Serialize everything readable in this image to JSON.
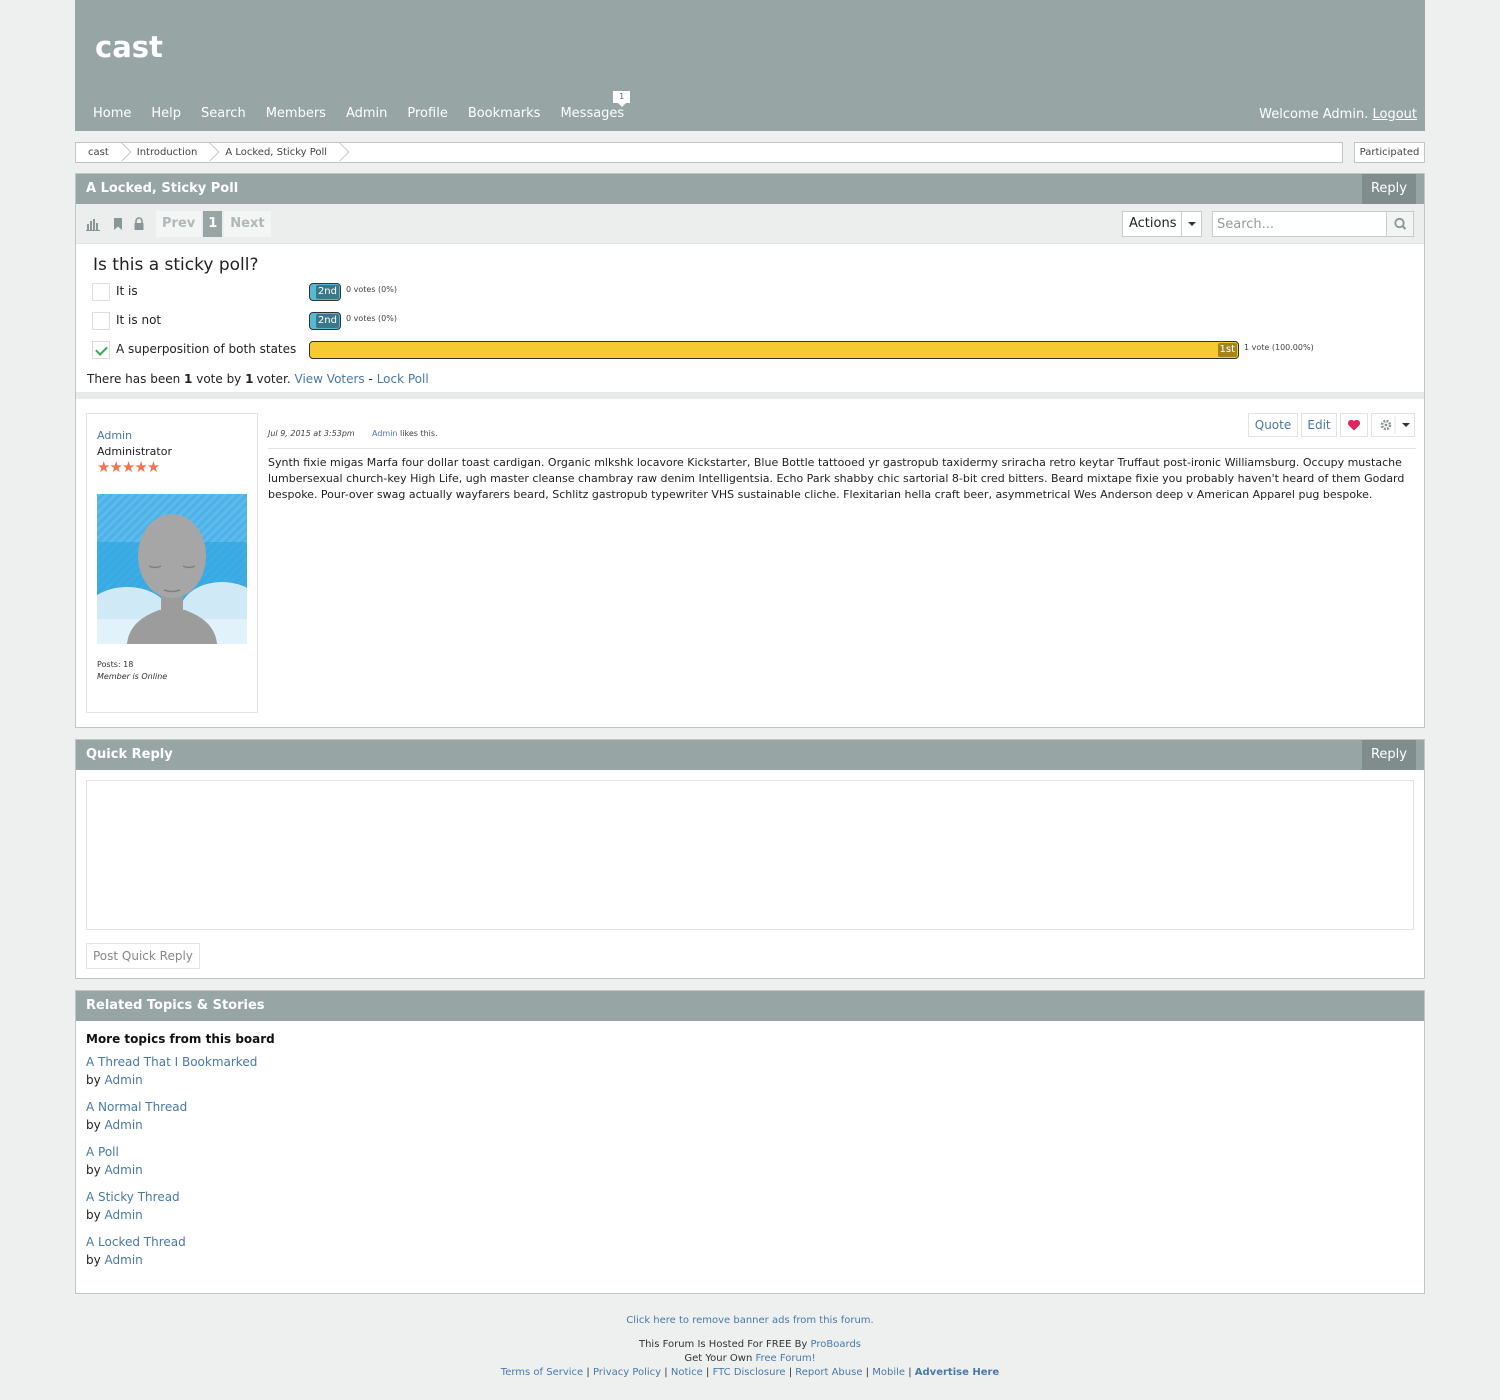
{
  "header": {
    "site_title": "cast",
    "nav": [
      {
        "label": "Home"
      },
      {
        "label": "Help"
      },
      {
        "label": "Search"
      },
      {
        "label": "Members"
      },
      {
        "label": "Admin"
      },
      {
        "label": "Profile"
      },
      {
        "label": "Bookmarks"
      },
      {
        "label": "Messages",
        "badge": "1"
      }
    ],
    "welcome_text": "Welcome Admin.",
    "logout_label": "Logout"
  },
  "breadcrumb": [
    "cast",
    "Introduction",
    "A Locked, Sticky Poll"
  ],
  "participated_label": "Participated",
  "thread": {
    "title": "A Locked, Sticky Poll",
    "reply_label": "Reply",
    "toolbar": {
      "icons": [
        "poll-icon",
        "bookmark-icon",
        "lock-icon"
      ],
      "prev_label": "Prev",
      "current_page": "1",
      "next_label": "Next",
      "actions_label": "Actions",
      "search_placeholder": "Search..."
    },
    "poll": {
      "question": "Is this a sticky poll?",
      "options": [
        {
          "label": "It is",
          "rank": "2nd",
          "votes_text": "0 votes (0%)",
          "checked": false,
          "color": "#58b9d1",
          "fraction": 0.0
        },
        {
          "label": "It is not",
          "rank": "2nd",
          "votes_text": "0 votes (0%)",
          "checked": false,
          "color": "#58b9d1",
          "fraction": 0.0
        },
        {
          "label": "A superposition of both states",
          "rank": "1st",
          "votes_text": "1 vote (100.00%)",
          "checked": true,
          "color": "#f6cb31",
          "fraction": 1.0
        }
      ],
      "summary_prefix": "There has been",
      "vote_count": "1",
      "summary_mid": "vote by",
      "voter_count": "1",
      "summary_suffix": "voter.",
      "view_voters_label": "View Voters",
      "summary_dash": "-",
      "lock_poll_label": "Lock Poll"
    },
    "post": {
      "author": "Admin",
      "author_title": "Administrator",
      "stars": "★★★★★",
      "posts_count": "Posts: 18",
      "online_status": "Member is Online",
      "date": "Jul 9, 2015 at 3:53pm",
      "likes_user": "Admin",
      "likes_text": "likes this.",
      "quote_label": "Quote",
      "edit_label": "Edit",
      "body": "Synth fixie migas Marfa four dollar toast cardigan. Organic mlkshk locavore Kickstarter, Blue Bottle tattooed yr gastropub taxidermy sriracha retro keytar Truffaut post-ironic Williamsburg. Occupy mustache lumbersexual church-key High Life, ugh master cleanse chambray raw denim Intelligentsia. Echo Park shabby chic sartorial 8-bit cred bitters. Beard mixtape fixie you probably haven't heard of them Godard bespoke. Pour-over swag actually wayfarers beard, Schlitz gastropub typewriter VHS sustainable cliche. Flexitarian hella craft beer, asymmetrical Wes Anderson deep v American Apparel pug bespoke."
    }
  },
  "quick_reply": {
    "title": "Quick Reply",
    "reply_label": "Reply",
    "submit_label": "Post Quick Reply"
  },
  "related": {
    "title": "Related Topics & Stories",
    "heading": "More topics from this board",
    "by_label": "by",
    "topics": [
      {
        "title": "A Thread That I Bookmarked",
        "author": "Admin"
      },
      {
        "title": "A Normal Thread",
        "author": "Admin"
      },
      {
        "title": "A Poll",
        "author": "Admin"
      },
      {
        "title": "A Sticky Thread",
        "author": "Admin"
      },
      {
        "title": "A Locked Thread",
        "author": "Admin"
      }
    ]
  },
  "footer": {
    "remove_ads": "Click here to remove banner ads from this forum.",
    "hosted_text": "This Forum Is Hosted For FREE By",
    "hosted_link": "ProBoards",
    "get_own_text": "Get Your Own",
    "get_own_link": "Free Forum!",
    "links": [
      "Terms of Service",
      "Privacy Policy",
      "Notice",
      "FTC Disclosure",
      "Report Abuse",
      "Mobile",
      "Advertise Here"
    ]
  },
  "colors": {
    "header_bg": "#97a6a5",
    "link": "#4a78a8",
    "poll_leader": "#f6cb31",
    "poll_other": "#58b9d1",
    "like_heart": "#e0245e",
    "stars": "#f2734e"
  }
}
